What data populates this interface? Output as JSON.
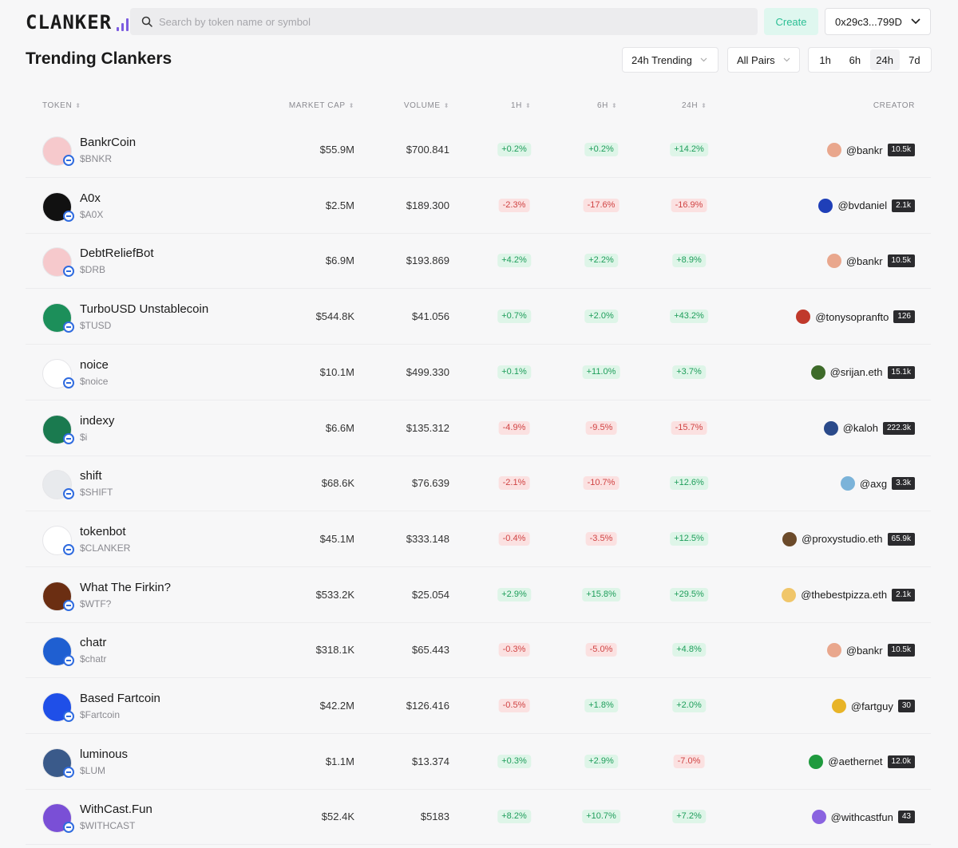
{
  "header": {
    "logo_text": "CLANKER",
    "search_placeholder": "Search by token name or symbol",
    "create_label": "Create",
    "wallet_address": "0x29c3...799D"
  },
  "page": {
    "title": "Trending Clankers",
    "filters": {
      "sort_label": "24h Trending",
      "pairs_label": "All Pairs",
      "timeframes": [
        "1h",
        "6h",
        "24h",
        "7d"
      ],
      "active_timeframe": "24h"
    }
  },
  "table": {
    "columns": {
      "token": "TOKEN",
      "market_cap": "MARKET CAP",
      "volume": "VOLUME",
      "h1": "1H",
      "h6": "6H",
      "h24": "24H",
      "creator": "CREATOR"
    },
    "rows": [
      {
        "name": "BankrCoin",
        "symbol": "$BNKR",
        "market_cap": "$55.9M",
        "volume": "$700.841",
        "h1": "+0.2%",
        "h6": "+0.2%",
        "h24": "+14.2%",
        "creator": "@bankr",
        "followers": "10.5k",
        "avatar_color": "#f6c9cc",
        "creator_color": "#e9a78d"
      },
      {
        "name": "A0x",
        "symbol": "$A0X",
        "market_cap": "$2.5M",
        "volume": "$189.300",
        "h1": "-2.3%",
        "h6": "-17.6%",
        "h24": "-16.9%",
        "creator": "@bvdaniel",
        "followers": "2.1k",
        "avatar_color": "#111111",
        "creator_color": "#1f3fb8"
      },
      {
        "name": "DebtReliefBot",
        "symbol": "$DRB",
        "market_cap": "$6.9M",
        "volume": "$193.869",
        "h1": "+4.2%",
        "h6": "+2.2%",
        "h24": "+8.9%",
        "creator": "@bankr",
        "followers": "10.5k",
        "avatar_color": "#f6c9cc",
        "creator_color": "#e9a78d"
      },
      {
        "name": "TurboUSD Unstablecoin",
        "symbol": "$TUSD",
        "market_cap": "$544.8K",
        "volume": "$41.056",
        "h1": "+0.7%",
        "h6": "+2.0%",
        "h24": "+43.2%",
        "creator": "@tonysopranfto",
        "followers": "126",
        "avatar_color": "#1c8f5a",
        "creator_color": "#c0392b"
      },
      {
        "name": "noice",
        "symbol": "$noice",
        "market_cap": "$10.1M",
        "volume": "$499.330",
        "h1": "+0.1%",
        "h6": "+11.0%",
        "h24": "+3.7%",
        "creator": "@srijan.eth",
        "followers": "15.1k",
        "avatar_color": "#ffffff",
        "creator_color": "#3e6b2a"
      },
      {
        "name": "indexy",
        "symbol": "$i",
        "market_cap": "$6.6M",
        "volume": "$135.312",
        "h1": "-4.9%",
        "h6": "-9.5%",
        "h24": "-15.7%",
        "creator": "@kaloh",
        "followers": "222.3k",
        "avatar_color": "#1a7a4f",
        "creator_color": "#2a4a8a"
      },
      {
        "name": "shift",
        "symbol": "$SHIFT",
        "market_cap": "$68.6K",
        "volume": "$76.639",
        "h1": "-2.1%",
        "h6": "-10.7%",
        "h24": "+12.6%",
        "creator": "@axg",
        "followers": "3.3k",
        "avatar_color": "#e8eaed",
        "creator_color": "#7bb3d9"
      },
      {
        "name": "tokenbot",
        "symbol": "$CLANKER",
        "market_cap": "$45.1M",
        "volume": "$333.148",
        "h1": "-0.4%",
        "h6": "-3.5%",
        "h24": "+12.5%",
        "creator": "@proxystudio.eth",
        "followers": "65.9k",
        "avatar_color": "#ffffff",
        "creator_color": "#6b4a2a"
      },
      {
        "name": "What The Firkin?",
        "symbol": "$WTF?",
        "market_cap": "$533.2K",
        "volume": "$25.054",
        "h1": "+2.9%",
        "h6": "+15.8%",
        "h24": "+29.5%",
        "creator": "@thebestpizza.eth",
        "followers": "2.1k",
        "avatar_color": "#6b2e12",
        "creator_color": "#f0c66a"
      },
      {
        "name": "chatr",
        "symbol": "$chatr",
        "market_cap": "$318.1K",
        "volume": "$65.443",
        "h1": "-0.3%",
        "h6": "-5.0%",
        "h24": "+4.8%",
        "creator": "@bankr",
        "followers": "10.5k",
        "avatar_color": "#1f5fd1",
        "creator_color": "#e9a78d"
      },
      {
        "name": "Based Fartcoin",
        "symbol": "$Fartcoin",
        "market_cap": "$42.2M",
        "volume": "$126.416",
        "h1": "-0.5%",
        "h6": "+1.8%",
        "h24": "+2.0%",
        "creator": "@fartguy",
        "followers": "30",
        "avatar_color": "#1f4fe8",
        "creator_color": "#e8b428"
      },
      {
        "name": "luminous",
        "symbol": "$LUM",
        "market_cap": "$1.1M",
        "volume": "$13.374",
        "h1": "+0.3%",
        "h6": "+2.9%",
        "h24": "-7.0%",
        "creator": "@aethernet",
        "followers": "12.0k",
        "avatar_color": "#3a5a8a",
        "creator_color": "#1f9a3e"
      },
      {
        "name": "WithCast.Fun",
        "symbol": "$WITHCAST",
        "market_cap": "$52.4K",
        "volume": "$5183",
        "h1": "+8.2%",
        "h6": "+10.7%",
        "h24": "+7.2%",
        "creator": "@withcastfun",
        "followers": "43",
        "avatar_color": "#7a4fd6",
        "creator_color": "#8a63e0"
      }
    ]
  },
  "colors": {
    "accent": "#7c5ce0",
    "positive": "#1f9e5b",
    "negative": "#d04444",
    "create_text": "#2bbf94"
  }
}
